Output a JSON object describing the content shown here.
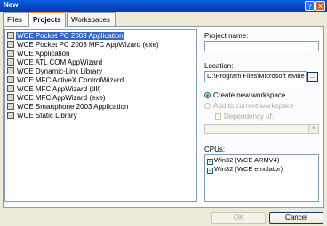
{
  "window": {
    "title": "New",
    "help_label": "?",
    "close_label": "✕"
  },
  "tabs": [
    {
      "label": "Files"
    },
    {
      "label": "Projects"
    },
    {
      "label": "Workspaces"
    }
  ],
  "project_types": [
    {
      "label": "WCE Pocket PC 2003 Application",
      "icon": "wce-project-icon",
      "selected": true
    },
    {
      "label": "WCE Pocket PC 2003 MFC AppWizard (exe)",
      "icon": "wce-project-icon",
      "selected": false
    },
    {
      "label": "WCE Application",
      "icon": "wce-project-icon",
      "selected": false
    },
    {
      "label": "WCE ATL COM AppWizard",
      "icon": "wce-project-icon",
      "selected": false
    },
    {
      "label": "WCE Dynamic-Link Library",
      "icon": "wce-project-icon",
      "selected": false
    },
    {
      "label": "WCE MFC ActiveX ControlWizard",
      "icon": "wce-project-icon",
      "selected": false
    },
    {
      "label": "WCE MFC AppWizard (dll)",
      "icon": "wce-project-icon",
      "selected": false
    },
    {
      "label": "WCE MFC AppWizard (exe)",
      "icon": "wce-project-icon",
      "selected": false
    },
    {
      "label": "WCE Smartphone 2003 Application",
      "icon": "wce-project-icon",
      "selected": false
    },
    {
      "label": "WCE Static Library",
      "icon": "wce-project-icon",
      "selected": false
    }
  ],
  "project_name": {
    "label": "Project name:",
    "value": ""
  },
  "location": {
    "label": "Location:",
    "value": "D:\\Program Files\\Microsoft eMbe",
    "browse_label": "..."
  },
  "workspace_options": {
    "create_new": "Create new workspace",
    "add_current": "Add to current workspace",
    "dependency": "Dependency of:"
  },
  "cpus": {
    "label": "CPUs:",
    "items": [
      {
        "label": "Win32 (WCE ARMV4)",
        "checked": true
      },
      {
        "label": "Win32 (WCE emulator)",
        "checked": true
      }
    ]
  },
  "buttons": {
    "ok": "OK",
    "cancel": "Cancel"
  },
  "colors": {
    "titlebar": "#0b45c4",
    "selection": "#316ac5",
    "dialog_bg": "#ece9d8"
  }
}
